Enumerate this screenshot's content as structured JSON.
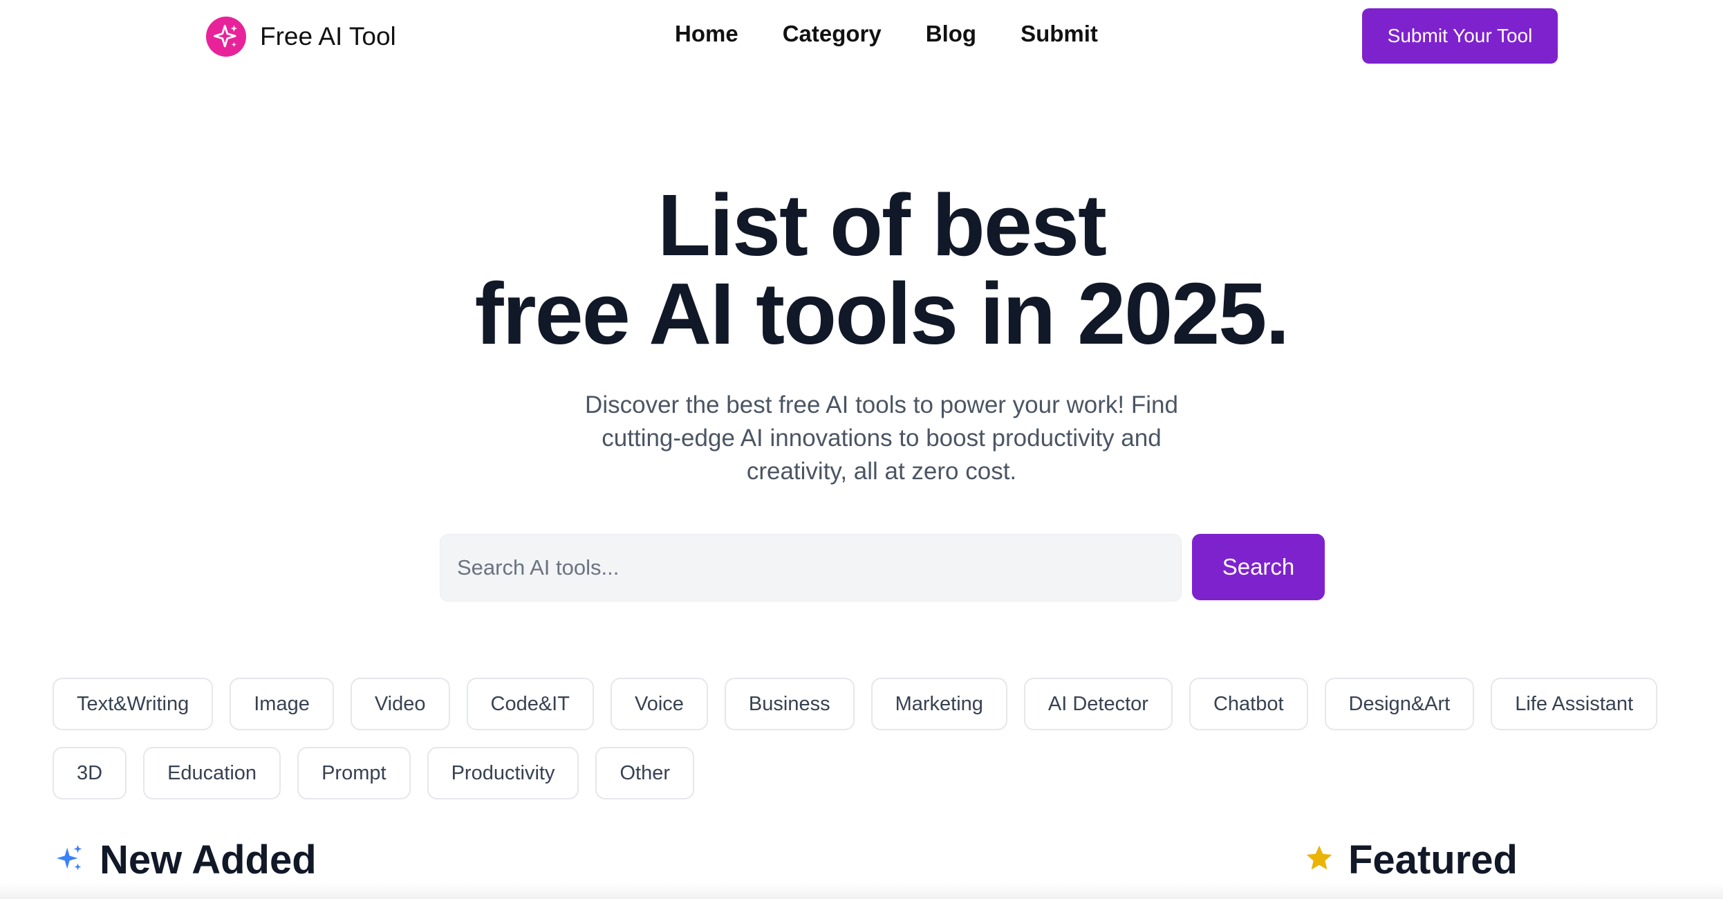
{
  "brand": {
    "name": "Free AI Tool",
    "logo_icon": "sparkle-icon",
    "logo_color": "#e8239a"
  },
  "nav": {
    "items": [
      "Home",
      "Category",
      "Blog",
      "Submit"
    ]
  },
  "header": {
    "submit_button": "Submit Your Tool"
  },
  "hero": {
    "title_line1": "List of best",
    "title_line2": "free AI tools in 2025.",
    "subtitle": "Discover the best free AI tools to power your work! Find cutting-edge AI innovations to boost productivity and creativity, all at zero cost."
  },
  "search": {
    "placeholder": "Search AI tools...",
    "button": "Search"
  },
  "categories": [
    "Text&Writing",
    "Image",
    "Video",
    "Code&IT",
    "Voice",
    "Business",
    "Marketing",
    "AI Detector",
    "Chatbot",
    "Design&Art",
    "Life Assistant",
    "3D",
    "Education",
    "Prompt",
    "Productivity",
    "Other"
  ],
  "sections": {
    "new_added": {
      "title": "New Added",
      "icon": "sparkles-icon"
    },
    "featured": {
      "title": "Featured",
      "icon": "star-icon"
    }
  },
  "colors": {
    "accent": "#7e22ce",
    "star": "#eab308",
    "sparkles": "#3b82f6"
  }
}
